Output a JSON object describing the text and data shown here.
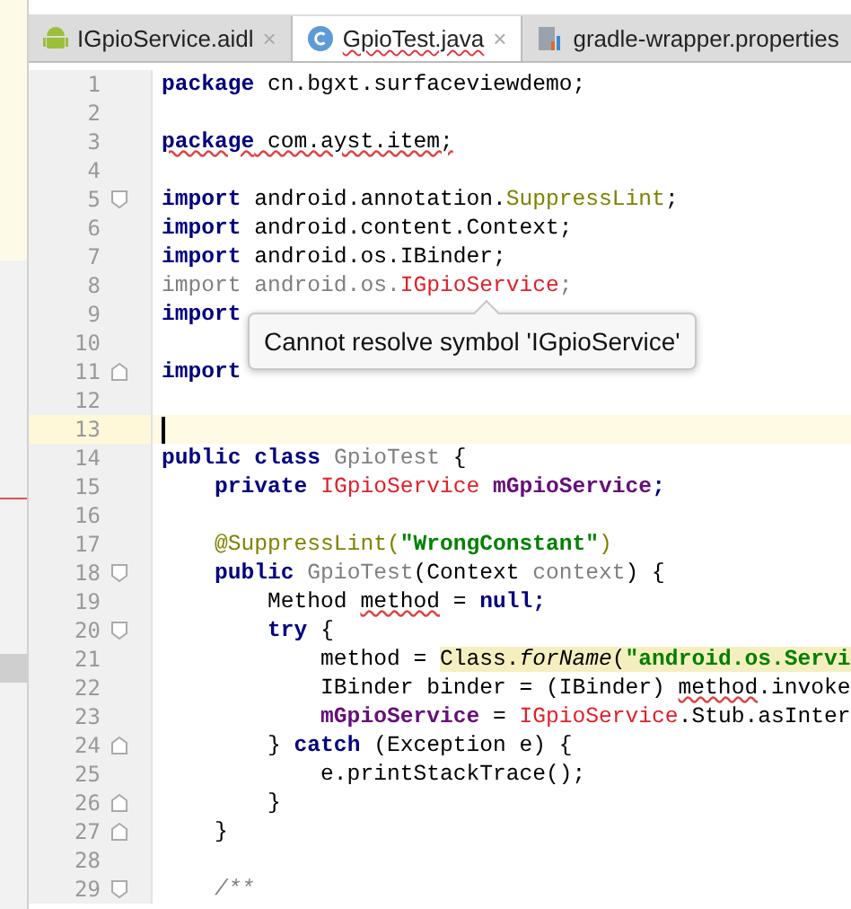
{
  "tabs": [
    {
      "label": "IGpioService.aidl",
      "kind": "android",
      "selected": false,
      "error": false,
      "close": "×"
    },
    {
      "label": "GpioTest.java",
      "kind": "class",
      "selected": true,
      "error": true,
      "close": "×"
    },
    {
      "label": "gradle-wrapper.properties",
      "kind": "gradle",
      "selected": false,
      "error": false
    }
  ],
  "lines": [
    {
      "number": "1",
      "current": false,
      "kind": "plain",
      "tokens": [
        {
          "text": "package",
          "kind": "kw"
        },
        {
          "text": " cn.bgxt.surfaceviewdemo;",
          "kind": "plain"
        }
      ]
    },
    {
      "number": "2",
      "current": false,
      "kind": "plain"
    },
    {
      "number": "3",
      "current": false,
      "kind": "plain",
      "tokens": [
        {
          "text": "package",
          "kind": "kw",
          "squiggle": true
        },
        {
          "text": " com.ayst.item;",
          "kind": "plain",
          "squiggle": true
        }
      ]
    },
    {
      "number": "4",
      "current": false,
      "kind": "plain"
    },
    {
      "number": "5",
      "current": false,
      "kind": "start",
      "tokens": [
        {
          "text": "import",
          "kind": "kw"
        },
        {
          "text": " android.annotation.",
          "kind": "plain"
        },
        {
          "text": "SuppressLint",
          "kind": "annot"
        },
        {
          "text": ";",
          "kind": "plain"
        }
      ]
    },
    {
      "number": "6",
      "current": false,
      "kind": "plain",
      "tokens": [
        {
          "text": "import",
          "kind": "kw"
        },
        {
          "text": " android.content.Context;",
          "kind": "plain"
        }
      ]
    },
    {
      "number": "7",
      "current": false,
      "kind": "plain",
      "tokens": [
        {
          "text": "import",
          "kind": "kw"
        },
        {
          "text": " android.os.IBinder;",
          "kind": "plain"
        }
      ]
    },
    {
      "number": "8",
      "current": false,
      "kind": "plain",
      "tokens": [
        {
          "text": "import android.os.",
          "kind": "unused"
        },
        {
          "text": "IGpioService",
          "kind": "error"
        },
        {
          "text": ";",
          "kind": "unused"
        }
      ]
    },
    {
      "number": "9",
      "current": false,
      "kind": "plain",
      "tokens": [
        {
          "text": "import",
          "kind": "kw"
        }
      ]
    },
    {
      "number": "10",
      "current": false,
      "kind": "plain"
    },
    {
      "number": "11",
      "current": false,
      "kind": "end",
      "tokens": [
        {
          "text": "import",
          "kind": "kw"
        }
      ]
    },
    {
      "number": "12",
      "current": false,
      "kind": "plain"
    },
    {
      "number": "13",
      "current": true,
      "kind": "plain"
    },
    {
      "number": "14",
      "current": false,
      "kind": "plain",
      "tokens": [
        {
          "text": "public class",
          "kind": "kw"
        },
        {
          "text": " GpioTest",
          "kind": "unused"
        },
        {
          "text": " {",
          "kind": "plain"
        }
      ]
    },
    {
      "number": "15",
      "current": false,
      "kind": "plain",
      "tokens": [
        {
          "text": "    private",
          "kind": "kw"
        },
        {
          "text": " IGpioService",
          "kind": "error"
        },
        {
          "text": " mGpioService",
          "kind": "field"
        },
        {
          "text": ";",
          "kind": "kw"
        }
      ]
    },
    {
      "number": "16",
      "current": false,
      "kind": "plain"
    },
    {
      "number": "17",
      "current": false,
      "kind": "plain",
      "tokens": [
        {
          "text": "    @SuppressLint(",
          "kind": "annot"
        },
        {
          "text": "\"WrongConstant\"",
          "kind": "string"
        },
        {
          "text": ")",
          "kind": "annot"
        }
      ]
    },
    {
      "number": "18",
      "current": false,
      "kind": "start",
      "tokens": [
        {
          "text": "    public",
          "kind": "kw"
        },
        {
          "text": " GpioTest",
          "kind": "unused"
        },
        {
          "text": "(Context ",
          "kind": "plain"
        },
        {
          "text": "context",
          "kind": "unused"
        },
        {
          "text": ") {",
          "kind": "plain"
        }
      ]
    },
    {
      "number": "19",
      "current": false,
      "kind": "plain",
      "tokens": [
        {
          "text": "        Method ",
          "kind": "plain"
        },
        {
          "text": "method",
          "kind": "plain",
          "squiggle": true
        },
        {
          "text": " = ",
          "kind": "plain"
        },
        {
          "text": "null",
          "kind": "kw"
        },
        {
          "text": ";",
          "kind": "kw"
        }
      ]
    },
    {
      "number": "20",
      "current": false,
      "kind": "start",
      "tokens": [
        {
          "text": "        try",
          "kind": "kw"
        },
        {
          "text": " {",
          "kind": "plain"
        }
      ]
    },
    {
      "number": "21",
      "current": false,
      "kind": "plain",
      "tokens": [
        {
          "text": "            method = ",
          "kind": "plain"
        },
        {
          "text": "Class.",
          "kind": "plain",
          "marked": true
        },
        {
          "text": "forName",
          "kind": "static",
          "marked": true
        },
        {
          "text": "(",
          "kind": "plain",
          "marked": true
        },
        {
          "text": "\"android.os.Servi",
          "kind": "string",
          "marked": true
        }
      ]
    },
    {
      "number": "22",
      "current": false,
      "kind": "plain",
      "tokens": [
        {
          "text": "            IBinder binder = (IBinder) ",
          "kind": "plain"
        },
        {
          "text": "method",
          "kind": "plain",
          "squiggle": true
        },
        {
          "text": ".invoke",
          "kind": "plain"
        }
      ]
    },
    {
      "number": "23",
      "current": false,
      "kind": "plain",
      "tokens": [
        {
          "text": "            mGpioService",
          "kind": "field"
        },
        {
          "text": " = ",
          "kind": "plain"
        },
        {
          "text": "IGpioService",
          "kind": "error"
        },
        {
          "text": ".Stub.asInter",
          "kind": "plain"
        }
      ]
    },
    {
      "number": "24",
      "current": false,
      "kind": "end",
      "tokens": [
        {
          "text": "        } ",
          "kind": "plain"
        },
        {
          "text": "catch",
          "kind": "kw"
        },
        {
          "text": " (Exception e) {",
          "kind": "plain"
        }
      ]
    },
    {
      "number": "25",
      "current": false,
      "kind": "plain",
      "tokens": [
        {
          "text": "            e.printStackTrace();",
          "kind": "plain"
        }
      ]
    },
    {
      "number": "26",
      "current": false,
      "kind": "end",
      "tokens": [
        {
          "text": "        }",
          "kind": "plain"
        }
      ]
    },
    {
      "number": "27",
      "current": false,
      "kind": "end",
      "tokens": [
        {
          "text": "    }",
          "kind": "plain"
        }
      ]
    },
    {
      "number": "28",
      "current": false,
      "kind": "plain"
    },
    {
      "number": "29",
      "current": false,
      "kind": "start",
      "tokens": [
        {
          "text": "    /**",
          "kind": "comment"
        }
      ]
    }
  ],
  "tooltip": {
    "text": "Cannot resolve symbol 'IGpioService'"
  }
}
